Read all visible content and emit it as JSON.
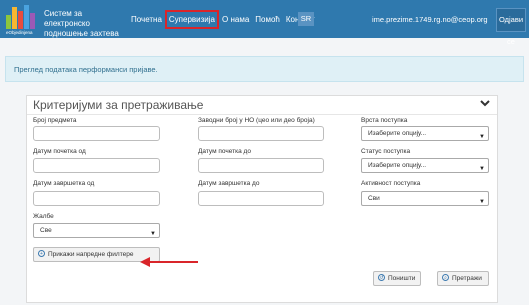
{
  "header": {
    "logo_text": "eObjedinjena",
    "app_title": "Систем за електронско подношење захтева",
    "nav": [
      "Почетна",
      "Супервизија",
      "О нама",
      "Помоћ",
      "Контакт"
    ],
    "lang": "SR",
    "user_email": "ime.prezime.1749.rg.no@ceop.org",
    "logout": "Одјави се"
  },
  "banner": {
    "text": "Преглед података перформанси пријаве."
  },
  "panel": {
    "title": "Критеријуми за претраживање",
    "fields": {
      "case_number": {
        "label": "Број предмета",
        "value": ""
      },
      "entry_number": {
        "label": "Заводни број у НО (цео или део броја)",
        "value": ""
      },
      "procedure_type": {
        "label": "Врста поступка",
        "value": "Изаберите опцију..."
      },
      "start_date_from": {
        "label": "Датум почетка од",
        "value": ""
      },
      "start_date_to": {
        "label": "Датум почетка до",
        "value": ""
      },
      "procedure_status": {
        "label": "Статус поступка",
        "value": "Изаберите опцију..."
      },
      "end_date_from": {
        "label": "Датум завршетка од",
        "value": ""
      },
      "end_date_to": {
        "label": "Датум завршетка до",
        "value": ""
      },
      "procedure_activity": {
        "label": "Активност поступка",
        "value": "Сви"
      },
      "complaints": {
        "label": "Жалбе",
        "value": "Све"
      }
    },
    "advanced_filters_button": "Прикажи напредне филтере",
    "reset_button": "Поништи",
    "search_button": "Претражи"
  }
}
